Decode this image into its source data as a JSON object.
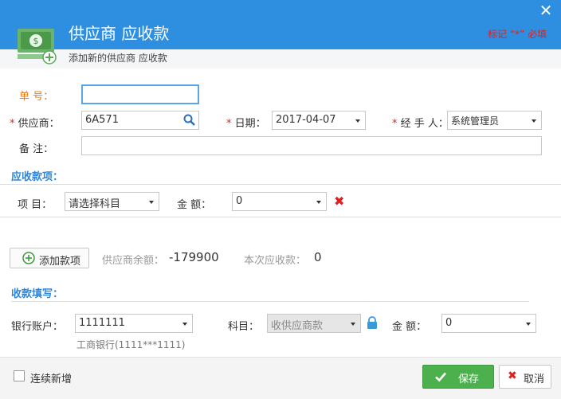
{
  "header": {
    "title": "供应商 应收款",
    "subtitle": "添加新的供应商 应收款",
    "required_note": "标记 “*” 必填",
    "close": "✕"
  },
  "form": {
    "order_no": {
      "label": "单    号：",
      "value": ""
    },
    "supplier": {
      "label": "供应商：",
      "value": "6A571"
    },
    "date": {
      "label": "日期：",
      "value": "2017-04-07"
    },
    "handler": {
      "label": "经 手 人：",
      "value": "系统管理员"
    },
    "remark": {
      "label": "备    注：",
      "value": ""
    },
    "required_mark": "*"
  },
  "receivable_items": {
    "section_title": "应收款项：",
    "item_label": "项    目：",
    "item_placeholder": "请选择科目",
    "amount_label": "金    额：",
    "amount_value": "0",
    "delete": "✖"
  },
  "summary": {
    "add_button": "添加款项",
    "balance_label": "供应商余额：",
    "balance_value": "-179900",
    "current_label": "本次应收款：",
    "current_value": "0"
  },
  "payment": {
    "section_title": "收款填写：",
    "account_label": "银行账户：",
    "account_value": "1111111",
    "account_hint": "工商银行(1111***1111)",
    "subject_label": "科目：",
    "subject_value": "收供应商款",
    "amount_label": "金    额：",
    "amount_value": "0"
  },
  "footer": {
    "continuous_add": "连续新增",
    "save": "保存",
    "cancel": "取消"
  },
  "colors": {
    "header": "#2e8fe0",
    "accent": "#2e86d8",
    "required": "#e02020",
    "save": "#4cb04c"
  }
}
